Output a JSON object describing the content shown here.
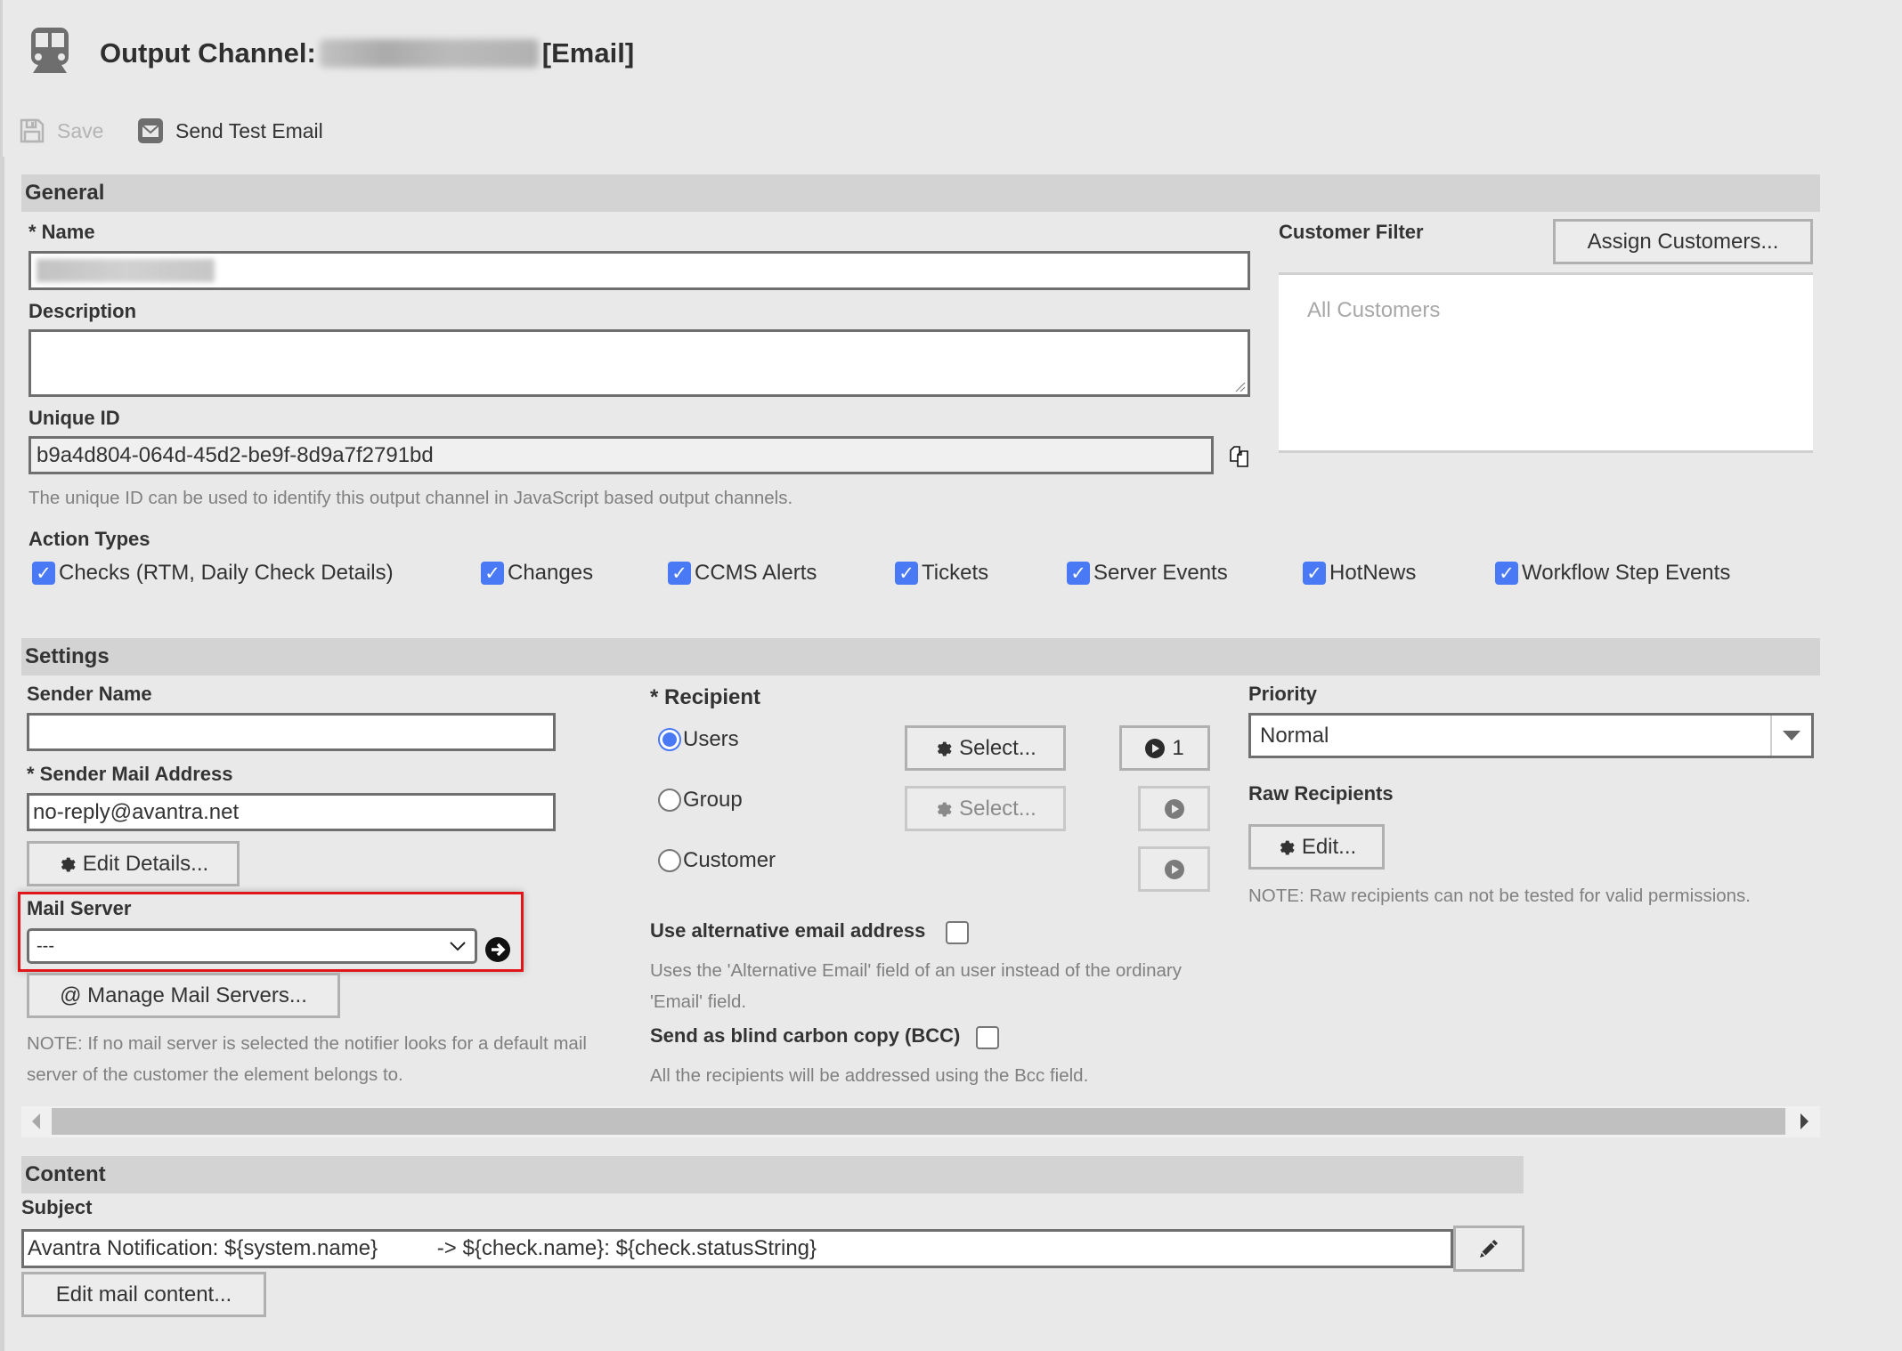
{
  "header": {
    "title_prefix": "Output Channel:",
    "title_suffix": "[Email]",
    "title_icon": "train-icon"
  },
  "toolbar": {
    "save_label": "Save",
    "send_test_label": "Send Test Email"
  },
  "general": {
    "section_title": "General",
    "name_label": "* Name",
    "description_label": "Description",
    "description_value": "",
    "unique_id_label": "Unique ID",
    "unique_id_value": "b9a4d804-064d-45d2-be9f-8d9a7f2791bd",
    "unique_id_note": "The unique ID can be used to identify this output channel in JavaScript based output channels.",
    "customer_filter_label": "Customer Filter",
    "assign_customers_label": "Assign Customers...",
    "customer_filter_value": "All Customers",
    "action_types_label": "Action Types",
    "action_types": [
      {
        "label": "Checks (RTM, Daily Check Details)",
        "checked": true
      },
      {
        "label": "Changes",
        "checked": true
      },
      {
        "label": "CCMS Alerts",
        "checked": true
      },
      {
        "label": "Tickets",
        "checked": true
      },
      {
        "label": "Server Events",
        "checked": true
      },
      {
        "label": "HotNews",
        "checked": true
      },
      {
        "label": "Workflow Step Events",
        "checked": true
      }
    ]
  },
  "settings": {
    "section_title": "Settings",
    "sender_name_label": "Sender Name",
    "sender_name_value": "",
    "sender_mail_label": "* Sender Mail Address",
    "sender_mail_value": "no-reply@avantra.net",
    "edit_details_label": "Edit Details...",
    "mail_server_label": "Mail Server",
    "mail_server_value": "---",
    "manage_mail_servers_label": "@ Manage Mail Servers...",
    "mail_server_note": "NOTE: If no mail server is selected the notifier looks for a default mail server of the customer the element belongs to.",
    "recipient_label": "* Recipient",
    "recipient_options": [
      {
        "label": "Users",
        "selected": true,
        "select_label": "Select...",
        "count": "1"
      },
      {
        "label": "Group",
        "selected": false,
        "select_label": "Select...",
        "count": ""
      },
      {
        "label": "Customer",
        "selected": false,
        "count": ""
      }
    ],
    "alt_email_label": "Use alternative email address",
    "alt_email_checked": false,
    "alt_email_note": "Uses the 'Alternative Email' field of an user instead of the ordinary 'Email' field.",
    "bcc_label": "Send as blind carbon copy (BCC)",
    "bcc_checked": false,
    "bcc_note": "All the recipients will be addressed using the Bcc field.",
    "priority_label": "Priority",
    "priority_value": "Normal",
    "raw_recipients_label": "Raw Recipients",
    "raw_edit_label": "Edit...",
    "raw_note": "NOTE: Raw recipients can not be tested for valid permissions."
  },
  "content": {
    "section_title": "Content",
    "subject_label": "Subject",
    "subject_value": "Avantra Notification: ${system.name}          -> ${check.name}: ${check.statusString}",
    "edit_mail_content_label": "Edit mail content..."
  },
  "colors": {
    "accent": "#4a79f6",
    "highlight": "#e0161a",
    "section_bar": "#d3d3d3",
    "background": "#e9e9e9"
  }
}
